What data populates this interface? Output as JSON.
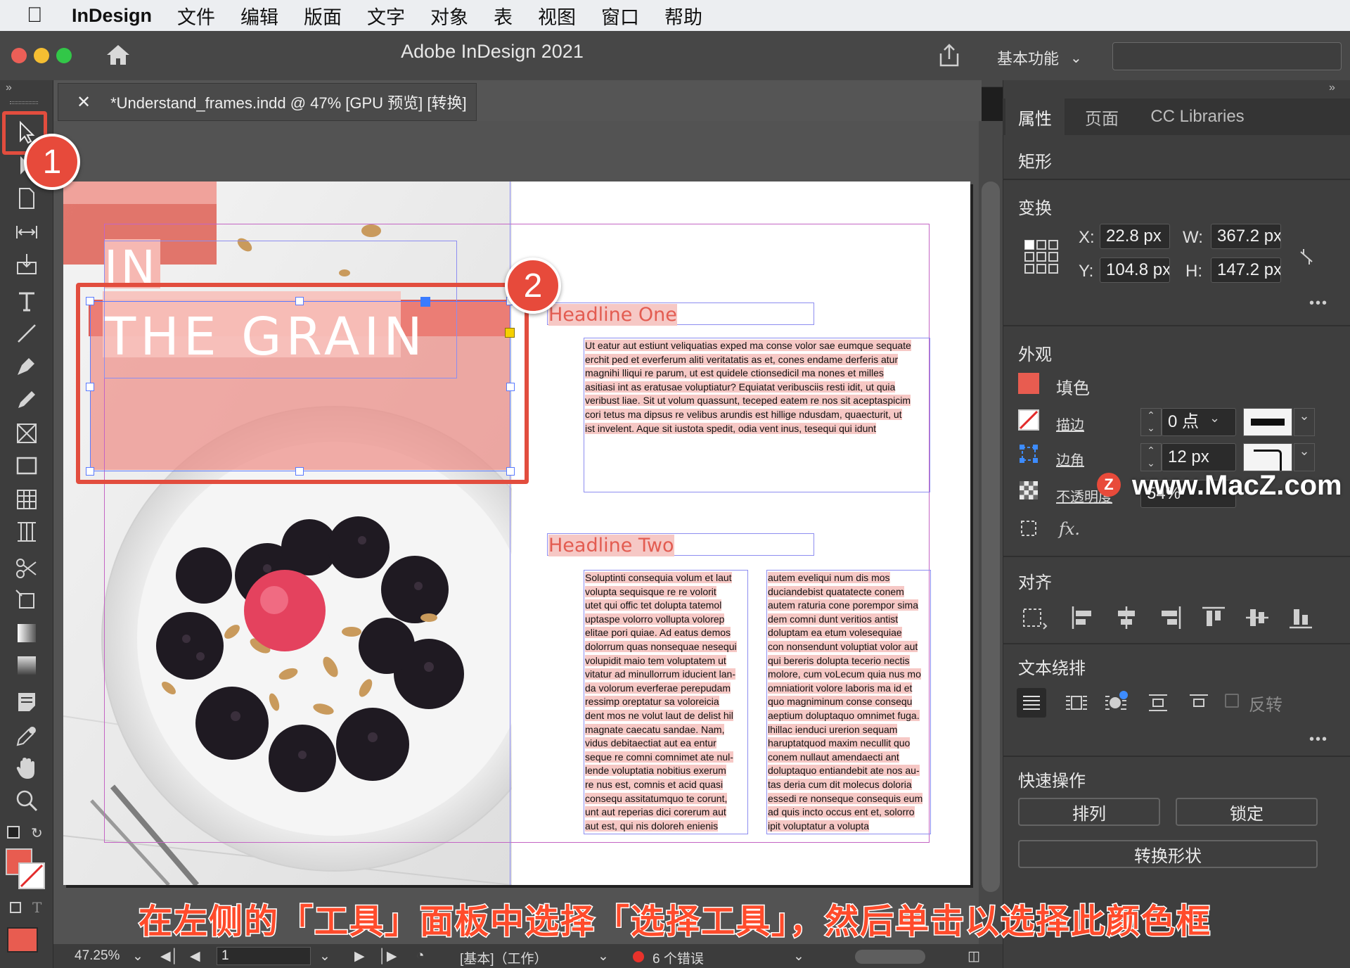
{
  "menubar": {
    "app_name": "InDesign",
    "items": [
      "文件",
      "编辑",
      "版面",
      "文字",
      "对象",
      "表",
      "视图",
      "窗口",
      "帮助"
    ]
  },
  "titlebar": {
    "title": "Adobe InDesign 2021",
    "workspace": "基本功能",
    "traffic_colors": [
      "#ec5f57",
      "#f5be32",
      "#32c748"
    ]
  },
  "document": {
    "tab_title": "*Understand_frames.indd @ 47% [GPU 预览] [转换]",
    "heading_small": "IN",
    "heading_big": "THE GRAIN",
    "headline_one": "Headline One",
    "headline_two": "Headline Two",
    "body_one": [
      "Ut eatur aut estiunt veliquatias exped ma conse volor sae eumque sequate",
      "erchit ped et everferum aliti veritatatis as et, cones endame derferis atur",
      "magnihi lliqui re parum, ut est quidele ctionsedicil ma nones et milles",
      "asitiasi int as eratusae voluptiatur? Equiatat veribusciis resti idit, ut quia",
      "veribust liae. Sit ut volum quassunt, teceped eatem re nos sit aceptaspicim",
      "cori tetus ma dipsus re velibus arundis est hillige ndusdam, quaecturit, ut",
      "ist invelent. Aque sit iustota spedit, odia vent inus, tesequi qui idunt"
    ],
    "body_two_left": [
      "Soluptinti consequia volum et laut",
      "volupta sequisque re re volorit",
      "utet qui offic tet dolupta tatemol",
      "uptaspe volorro vollupta volorep",
      "elitae pori quiae. Ad eatus demos",
      "dolorrum quas nonsequae nesequi",
      "volupidit maio tem voluptatem ut",
      "vitatur ad minullorrum iducient lan-",
      "da volorum everferae perepudam",
      "ressimp oreptatur sa voloreicia",
      "dent mos ne volut laut de delist hil",
      "magnate caecatu sandae. Nam,",
      "vidus debitaectiat aut ea entur",
      "seque re comni comnimet ate nul-",
      "lende voluptatia nobitius exerum",
      "re nus est, comnis et acid quasi",
      "consequ assitatumquo te corunt,",
      "unt aut reperias dici corerum aut",
      "aut est, qui nis doloreh enienis"
    ],
    "body_two_right": [
      "autem eveliqui num dis mos",
      "duciandebist quatatecte conem",
      "autem raturia cone porempor sima",
      "dem comni dunt veritios antist",
      "doluptam ea etum volesequiae",
      "con nonsendunt voluptiat volor aut",
      "qui bereris dolupta tecerio nectis",
      "molore, cum voLecum quia nus mo",
      "omniatiorit volore laboris ma id et",
      "quo magniminum conse consequ",
      "aeptium doluptaquo omnimet fuga.",
      "lhillac ienduci urerion sequam",
      "haruptatquod maxim necullit quo",
      "conem nullaut amendaecti ant",
      "doluptaquo entiandebit ate nos au-",
      "tas deria cum dit molecus doloria",
      "essedi re nonseque consequis eum",
      "ad quis incto occus ent et, solorro",
      "ipit voluptatur a volupta"
    ]
  },
  "badges": {
    "one": "1",
    "two": "2"
  },
  "panel": {
    "tabs": [
      "属性",
      "页面",
      "CC Libraries"
    ],
    "object_type": "矩形",
    "transform": {
      "title": "变换",
      "x_label": "X:",
      "x_value": "22.8 px",
      "y_label": "Y:",
      "y_value": "104.8 px",
      "w_label": "W:",
      "w_value": "367.2 px",
      "h_label": "H:",
      "h_value": "147.2 px"
    },
    "appearance": {
      "title": "外观",
      "fill_label": "填色",
      "fill_color": "#e85c50",
      "stroke_label": "描边",
      "stroke_value": "0 点",
      "corner_label": "边角",
      "corner_value": "12 px",
      "opacity_label": "不透明度",
      "opacity_value": "54%",
      "fx_label": "fx."
    },
    "align": {
      "title": "对齐"
    },
    "text_wrap": {
      "title": "文本绕排",
      "invert_label": "反转"
    },
    "quick_actions": {
      "title": "快速操作",
      "arrange": "排列",
      "lock": "锁定",
      "convert_shape": "转换形状"
    }
  },
  "statusbar": {
    "zoom": "47.25%",
    "page": "1",
    "profile": "[基本]（工作）",
    "errors": "6 个错误"
  },
  "caption": "在左侧的「工具」面板中选择「选择工具」，然后单击以选择此颜色框",
  "watermark": "www.MacZ.com",
  "colors": {
    "accent_red": "#e24d3e",
    "frame_pink": "#f3a7a1",
    "error_dot": "#e8322b"
  }
}
